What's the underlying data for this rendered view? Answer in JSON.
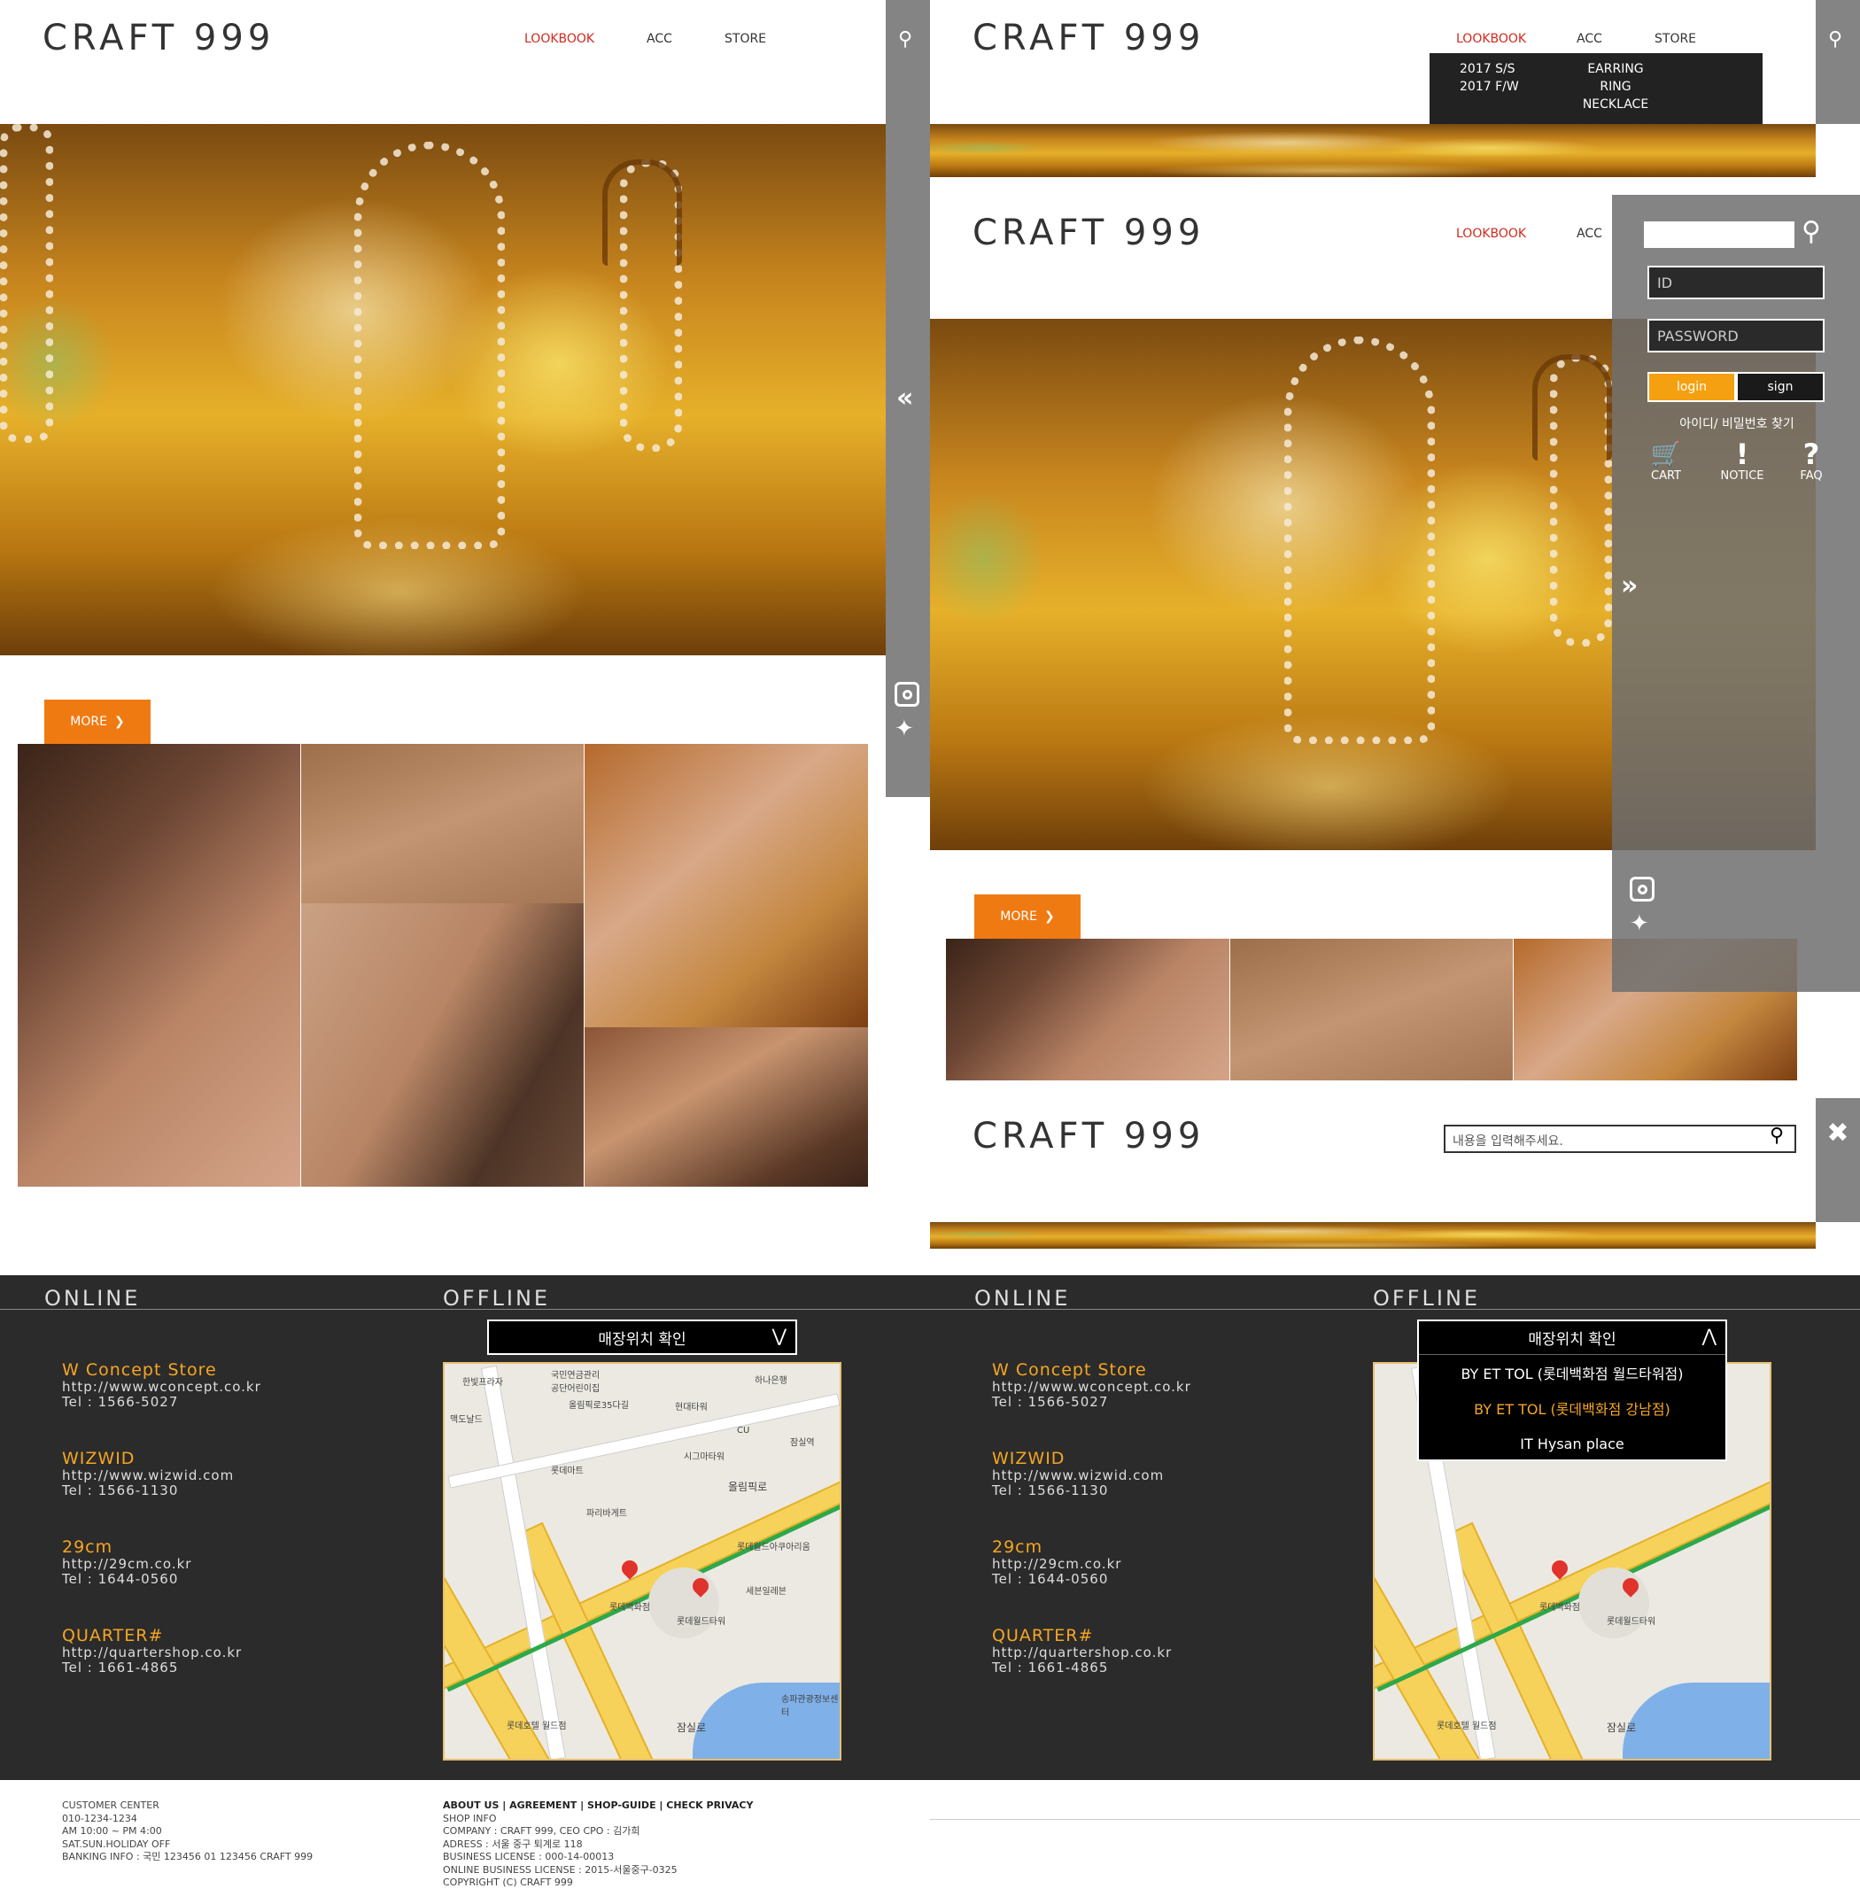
{
  "brand": {
    "logo": "CRAFT 999"
  },
  "nav": {
    "lookbook": "LOOKBOOK",
    "acc": "ACC",
    "store": "STORE"
  },
  "dropdown": {
    "lookbook_items": [
      "2017 S/S",
      "2017 F/W"
    ],
    "acc_items": [
      "EARRING",
      "RING",
      "NECKLACE"
    ]
  },
  "login_panel": {
    "id_placeholder": "ID",
    "password_placeholder": "PASSWORD",
    "login_label": "login",
    "sign_label": "sign",
    "find_label": "아이디/ 비밀번호 찾기",
    "cart_label": "CART",
    "notice_label": "NOTICE",
    "faq_label": "FAQ"
  },
  "search": {
    "placeholder": "내용을 입력해주세요."
  },
  "more_label": "MORE",
  "icons": {
    "search": "search-icon",
    "collapse": "double-chevron-left-icon",
    "expand": "double-chevron-right-icon",
    "instagram": "instagram-icon",
    "twitter": "twitter-icon",
    "close": "close-icon",
    "cart": "cart-icon",
    "notice": "exclamation-icon",
    "faq": "question-icon"
  },
  "colors": {
    "accent": "#f07a12",
    "active_nav": "#d12a1f",
    "store_name": "#f5a623",
    "footer_bg": "#2b2b2b"
  },
  "footer": {
    "online_title": "ONLINE",
    "offline_title": "OFFLINE",
    "stores": [
      {
        "name": "W Concept Store",
        "url": "http://www.wconcept.co.kr",
        "tel": "Tel : 1566-5027"
      },
      {
        "name": "WIZWID",
        "url": "http://www.wizwid.com",
        "tel": "Tel : 1566-1130"
      },
      {
        "name": "29cm",
        "url": "http://29cm.co.kr",
        "tel": "Tel : 1644-0560"
      },
      {
        "name": "QUARTER#",
        "url": "http://quartershop.co.kr",
        "tel": "Tel : 1661-4865"
      }
    ],
    "location_select": "매장위치 확인",
    "location_options": [
      "BY ET TOL (롯데백화점 월드타워점)",
      "BY ET TOL (롯데백화점 강남점)",
      "IT Hysan place"
    ],
    "map_labels": [
      "한빛프라자",
      "국민연금관리공단어린이집",
      "올림픽로35다길",
      "현대타워",
      "하나은행",
      "맥도날드",
      "롯데마트",
      "시그마타워",
      "CU",
      "잠실역",
      "파리바게트",
      "올림픽로",
      "롯데월드아쿠아리움",
      "세븐일레븐",
      "롯데백화점",
      "롯데월드타워",
      "롯데호텔 월드점",
      "송파관광정보센터",
      "잠실로"
    ],
    "customer_center": [
      "CUSTOMER CENTER",
      "010-1234-1234",
      "AM 10:00 ~ PM 4:00",
      "SAT.SUN.HOLIDAY OFF",
      "BANKING INFO : 국민 123456 01 123456 CRAFT 999"
    ],
    "links": [
      "ABOUT US",
      "AGREEMENT",
      "SHOP-GUIDE",
      "CHECK PRIVACY"
    ],
    "shop_info": [
      "SHOP INFO",
      "COMPANY : CRAFT 999, CEO CPO : 김가희",
      "ADRESS : 서울 중구 퇴계로 118",
      "BUSINESS LICENSE : 000-14-00013",
      "ONLINE BUSINESS LICENSE : 2015-서울중구-0325",
      "COPYRIGHT (C) CRAFT 999"
    ]
  }
}
